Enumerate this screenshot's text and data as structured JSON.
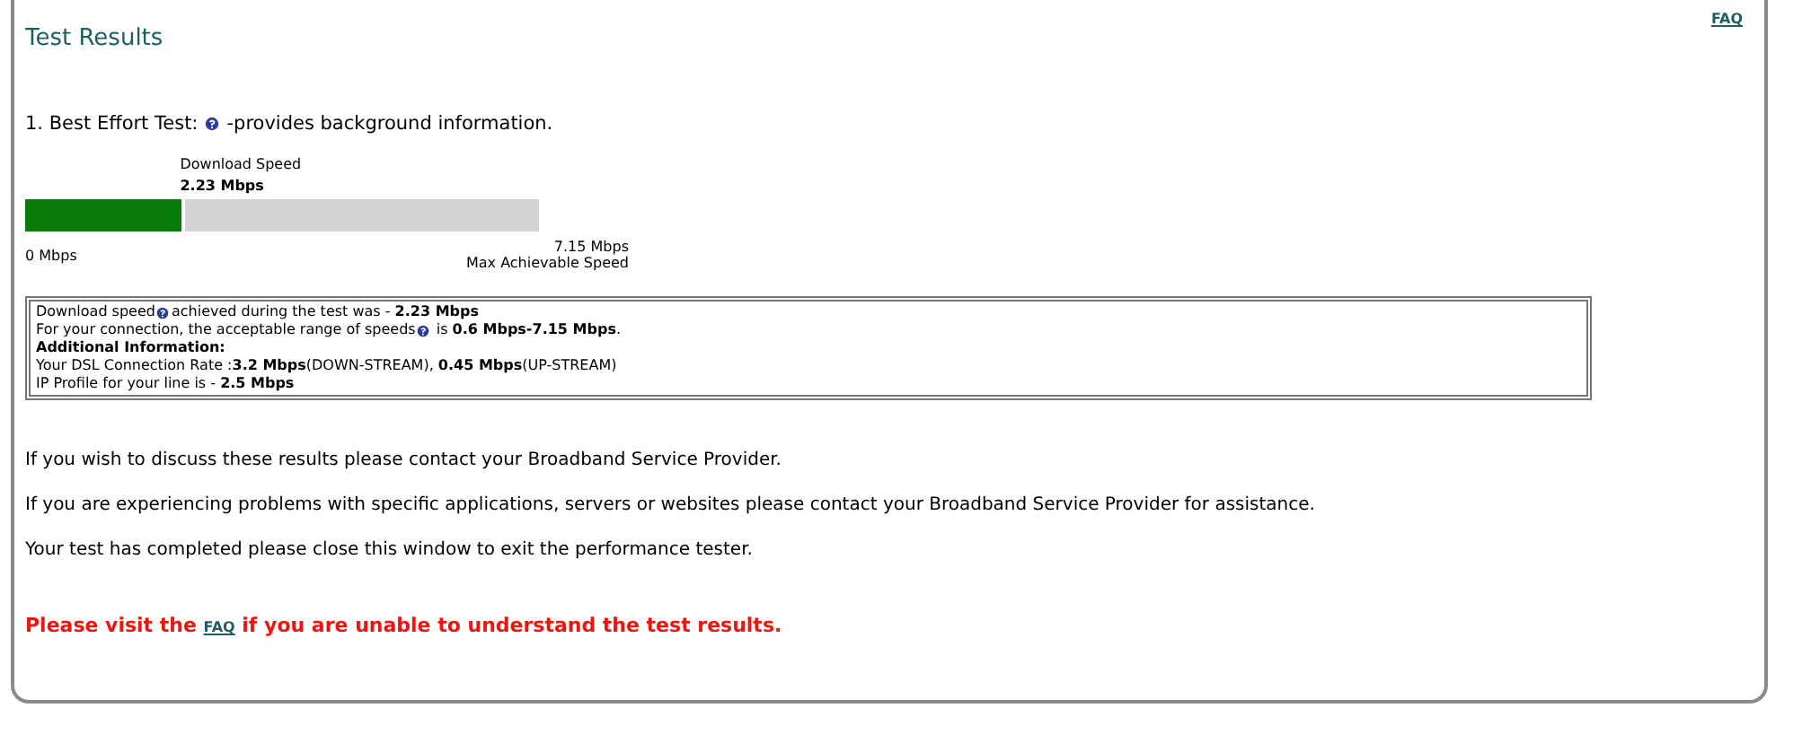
{
  "title": "Test Results",
  "faq_link": "FAQ",
  "test": {
    "heading_before": "1. Best Effort Test:",
    "heading_after": "-provides background information.",
    "meter": {
      "caption": "Download  Speed",
      "reading": "2.23 Mbps",
      "level": 0.312,
      "min_label": "0 Mbps",
      "max_label": "7.15 Mbps",
      "max_caption": "Max Achievable Speed"
    }
  },
  "info_lines": [
    {
      "before": "Download speed",
      "help": true,
      "after": "achieved during the test was - **2.23 Mbps**"
    },
    {
      "before": "For your connection, the acceptable range of speeds",
      "help": true,
      "after": " is **0.6 Mbps-7.15 Mbps**."
    },
    {
      "before": "**Additional Information:**",
      "help": false
    },
    {
      "before": "Your DSL Connection Rate :**3.2 Mbps**(DOWN-STREAM), **0.45 Mbps**(UP-STREAM)",
      "help": false
    },
    {
      "before": "IP Profile for your line is - **2.5 Mbps**",
      "help": false
    }
  ],
  "messages": [
    "If you wish to discuss these results please contact your Broadband Service Provider.",
    "If you are experiencing problems with specific applications, servers or websites please contact your Broadband Service Provider for assistance.",
    "Your test has completed please close this window to exit the performance tester."
  ],
  "notice": {
    "before": "Please visit the",
    "link": "FAQ",
    "after": "if you are unable to understand the test results."
  }
}
